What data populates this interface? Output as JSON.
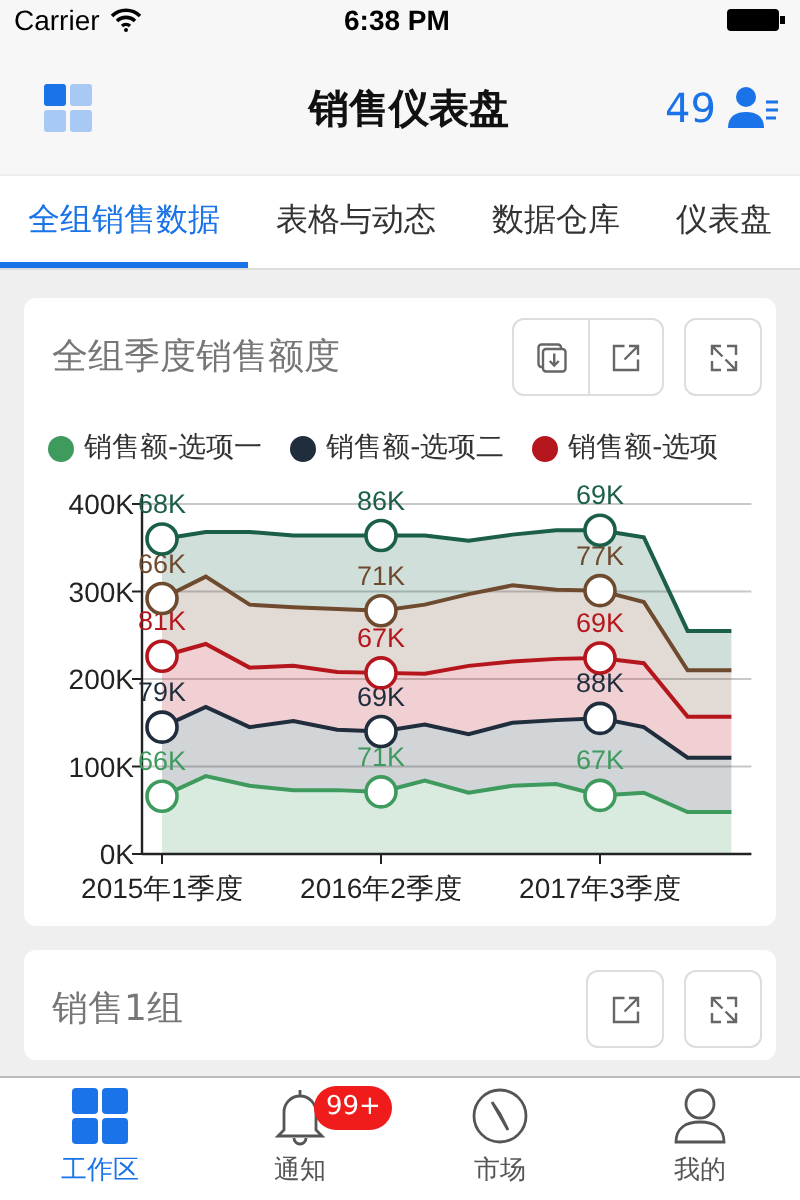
{
  "status_bar": {
    "carrier": "Carrier",
    "time": "6:38 PM"
  },
  "header": {
    "title": "销售仪表盘",
    "count": "49"
  },
  "tabs": [
    {
      "label": "全组销售数据",
      "selected": true
    },
    {
      "label": "表格与动态",
      "selected": false
    },
    {
      "label": "数据仓库",
      "selected": false
    },
    {
      "label": "仪表盘",
      "selected": false
    }
  ],
  "cards": [
    {
      "title": "全组季度销售额度",
      "action_groups": [
        [
          {
            "kind": "download"
          },
          {
            "kind": "share"
          }
        ],
        [
          {
            "kind": "expand"
          }
        ]
      ],
      "chart_data": {
        "type": "area",
        "stacked": true,
        "grid": true,
        "legend": true,
        "categories": [
          "2015年1季度",
          null,
          null,
          null,
          null,
          "2016年2季度",
          null,
          null,
          null,
          null,
          "2017年3季度",
          null,
          null,
          null
        ],
        "ylim": [
          0,
          400
        ],
        "yticks": [
          {
            "value": 0,
            "label": "0K"
          },
          {
            "value": 100,
            "label": "100K"
          },
          {
            "value": 200,
            "label": "200K"
          },
          {
            "value": 300,
            "label": "300K"
          },
          {
            "value": 400,
            "label": "400K"
          }
        ],
        "series": [
          {
            "name": "销售额-选项一",
            "color": "#3f9a5e",
            "values": [
              66,
              89,
              78,
              73,
              73,
              71,
              84,
              70,
              78,
              80,
              67,
              70,
              48,
              48
            ],
            "value_labels": [
              "66K",
              null,
              null,
              null,
              null,
              "71K",
              null,
              null,
              null,
              null,
              "67K",
              null,
              null,
              null
            ]
          },
          {
            "name": "销售额-选项二",
            "color": "#1f2d3d",
            "values": [
              79,
              79,
              67,
              79,
              69,
              69,
              64,
              67,
              72,
              73,
              88,
              75,
              62,
              62
            ],
            "value_labels": [
              "79K",
              null,
              null,
              null,
              null,
              "69K",
              null,
              null,
              null,
              null,
              "88K",
              null,
              null,
              null
            ]
          },
          {
            "name": "销售额-选项",
            "color": "#b5161d",
            "values": [
              81,
              72,
              68,
              63,
              66,
              67,
              58,
              78,
              70,
              70,
              69,
              73,
              47,
              47
            ],
            "value_labels": [
              "81K",
              null,
              null,
              null,
              null,
              "67K",
              null,
              null,
              null,
              null,
              "69K",
              null,
              null,
              null
            ]
          },
          {
            "color": "#6e4a2f",
            "values": [
              66,
              77,
              72,
              67,
              72,
              71,
              79,
              82,
              87,
              79,
              77,
              70,
              53,
              53
            ],
            "value_labels": [
              "66K",
              null,
              null,
              null,
              null,
              "71K",
              null,
              null,
              null,
              null,
              "77K",
              null,
              null,
              null
            ]
          },
          {
            "color": "#1b5e4a",
            "values": [
              68,
              51,
              83,
              82,
              84,
              86,
              79,
              61,
              58,
              68,
              69,
              74,
              45,
              45
            ],
            "value_labels": [
              "68K",
              null,
              null,
              null,
              null,
              "86K",
              null,
              null,
              null,
              null,
              "69K",
              null,
              null,
              null
            ]
          }
        ]
      }
    },
    {
      "title": "销售1组",
      "action_groups": [
        [
          {
            "kind": "share"
          }
        ],
        [
          {
            "kind": "expand"
          }
        ]
      ]
    }
  ],
  "bottom_tabs": [
    {
      "label": "工作区",
      "kind": "grid",
      "selected": true
    },
    {
      "label": "通知",
      "kind": "bell",
      "selected": false,
      "badge": "99+"
    },
    {
      "label": "市场",
      "kind": "compass",
      "selected": false
    },
    {
      "label": "我的",
      "kind": "person",
      "selected": false
    }
  ]
}
